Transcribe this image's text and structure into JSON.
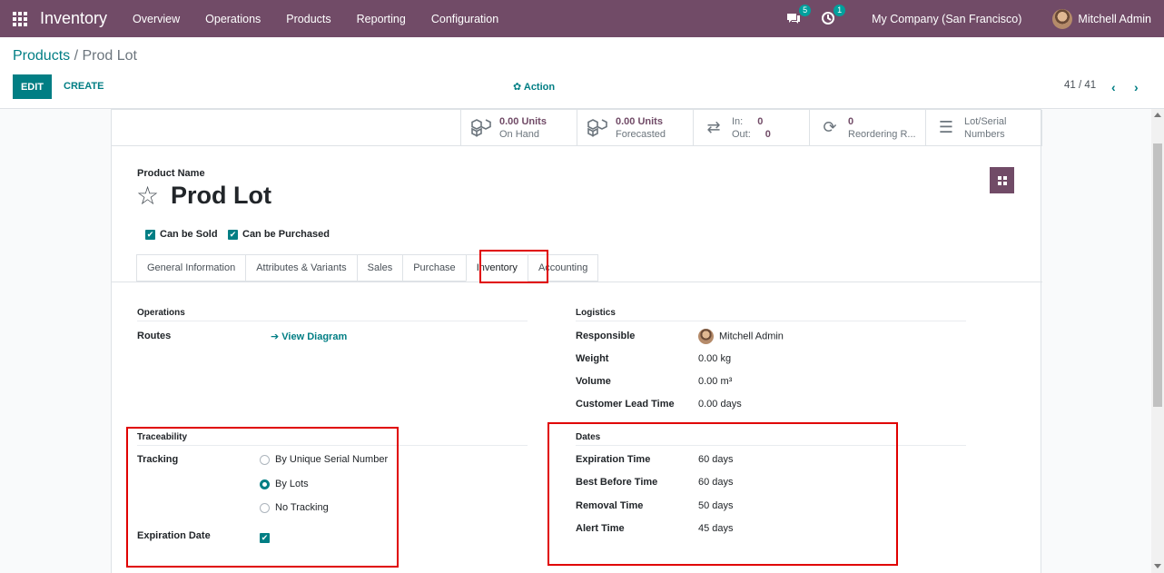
{
  "navbar": {
    "app_name": "Inventory",
    "menu": [
      "Overview",
      "Operations",
      "Products",
      "Reporting",
      "Configuration"
    ],
    "messages_count": "5",
    "activities_count": "1",
    "company": "My Company (San Francisco)",
    "user": "Mitchell Admin"
  },
  "breadcrumb": {
    "parent": "Products",
    "separator": "/",
    "current": "Prod Lot"
  },
  "toolbar": {
    "edit": "EDIT",
    "create": "CREATE",
    "action": "Action",
    "pager": "41 / 41"
  },
  "stats": {
    "on_hand_value": "0.00 Units",
    "on_hand_label": "On Hand",
    "forecast_value": "0.00 Units",
    "forecast_label": "Forecasted",
    "in_label": "In:",
    "in_value": "0",
    "out_label": "Out:",
    "out_value": "0",
    "reorder_value": "0",
    "reorder_label": "Reordering R...",
    "lot_label_1": "Lot/Serial",
    "lot_label_2": "Numbers"
  },
  "product": {
    "name_label": "Product Name",
    "name": "Prod Lot",
    "can_be_sold": "Can be Sold",
    "can_be_purchased": "Can be Purchased"
  },
  "tabs": [
    "General Information",
    "Attributes & Variants",
    "Sales",
    "Purchase",
    "Inventory",
    "Accounting"
  ],
  "operations": {
    "title": "Operations",
    "routes_label": "Routes",
    "view_diagram": "View Diagram"
  },
  "logistics": {
    "title": "Logistics",
    "responsible_label": "Responsible",
    "responsible": "Mitchell Admin",
    "weight_label": "Weight",
    "weight": "0.00",
    "weight_unit": "kg",
    "volume_label": "Volume",
    "volume": "0.00",
    "volume_unit": "m³",
    "lead_label": "Customer Lead Time",
    "lead": "0.00 days"
  },
  "traceability": {
    "title": "Traceability",
    "tracking_label": "Tracking",
    "options": [
      "By Unique Serial Number",
      "By Lots",
      "No Tracking"
    ],
    "selected": "By Lots",
    "expiration_label": "Expiration Date"
  },
  "dates": {
    "title": "Dates",
    "expiration_label": "Expiration Time",
    "expiration": "60 days",
    "best_before_label": "Best Before Time",
    "best_before": "60 days",
    "removal_label": "Removal Time",
    "removal": "50 days",
    "alert_label": "Alert Time",
    "alert": "45 days"
  }
}
